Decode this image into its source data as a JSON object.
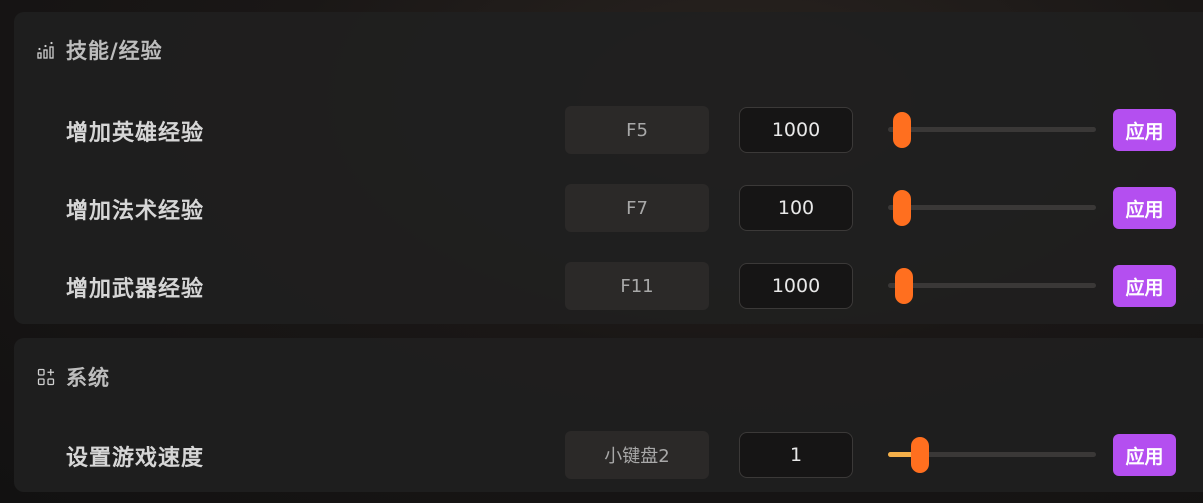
{
  "colors": {
    "apply_button": "#b44ff0",
    "slider_thumb": "#ff6f1f",
    "slider_fill": "#f5b04a",
    "panel_background": "#201f1f"
  },
  "skills_panel": {
    "icon": "bar-chart-icon",
    "title": "技能/经验",
    "rows": [
      {
        "label": "增加英雄经验",
        "hotkey": "F5",
        "value": "1000",
        "slider_level": 0.0,
        "apply_label": "应用"
      },
      {
        "label": "增加法术经验",
        "hotkey": "F7",
        "value": "100",
        "slider_level": 0.0,
        "apply_label": "应用"
      },
      {
        "label": "增加武器经验",
        "hotkey": "F11",
        "value": "1000",
        "slider_level": 0.01,
        "apply_label": "应用"
      }
    ]
  },
  "system_panel": {
    "icon": "apps-add-icon",
    "title": "系统",
    "rows": [
      {
        "label": "设置游戏速度",
        "hotkey": "小键盘2",
        "value": "1",
        "slider_level": 0.1,
        "apply_label": "应用"
      }
    ]
  }
}
